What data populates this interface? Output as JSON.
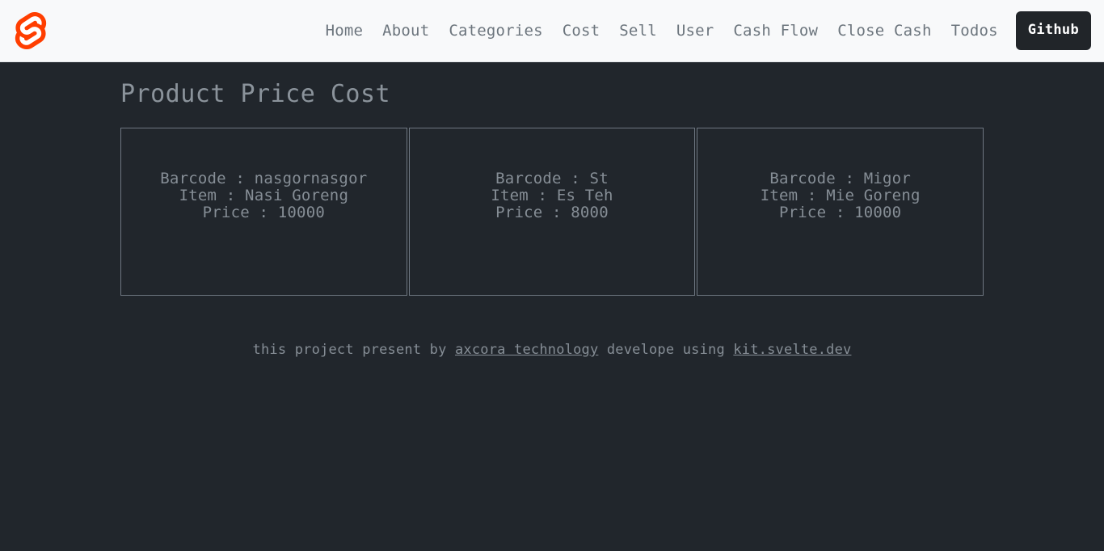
{
  "colors": {
    "page_bg": "#21262c",
    "navbar_bg": "#f8f9fa",
    "brand_accent": "#ff3e00",
    "nav_text": "#6c757d",
    "body_text": "#868e96",
    "card_border": "#6e7781",
    "github_btn_bg": "#212529"
  },
  "navbar": {
    "brand": {
      "icon": "svelte-logo-icon"
    },
    "links": [
      {
        "label": "Home"
      },
      {
        "label": "About"
      },
      {
        "label": "Categories"
      },
      {
        "label": "Cost"
      },
      {
        "label": "Sell"
      },
      {
        "label": "User"
      },
      {
        "label": "Cash Flow"
      },
      {
        "label": "Close Cash"
      },
      {
        "label": "Todos"
      }
    ],
    "github_button": {
      "label": "Github"
    }
  },
  "main": {
    "title": "Product Price Cost",
    "cards": [
      {
        "barcode_line": "Barcode : nasgornasgor",
        "item_line": "Item : Nasi Goreng",
        "price_line": "Price : 10000"
      },
      {
        "barcode_line": "Barcode : St",
        "item_line": "Item : Es Teh",
        "price_line": "Price : 8000"
      },
      {
        "barcode_line": "Barcode : Migor",
        "item_line": "Item : Mie Goreng",
        "price_line": "Price : 10000"
      }
    ]
  },
  "footer": {
    "text_before": "this project present by ",
    "link1": "axcora technology",
    "text_middle": " develope using ",
    "link2": "kit.svelte.dev"
  }
}
